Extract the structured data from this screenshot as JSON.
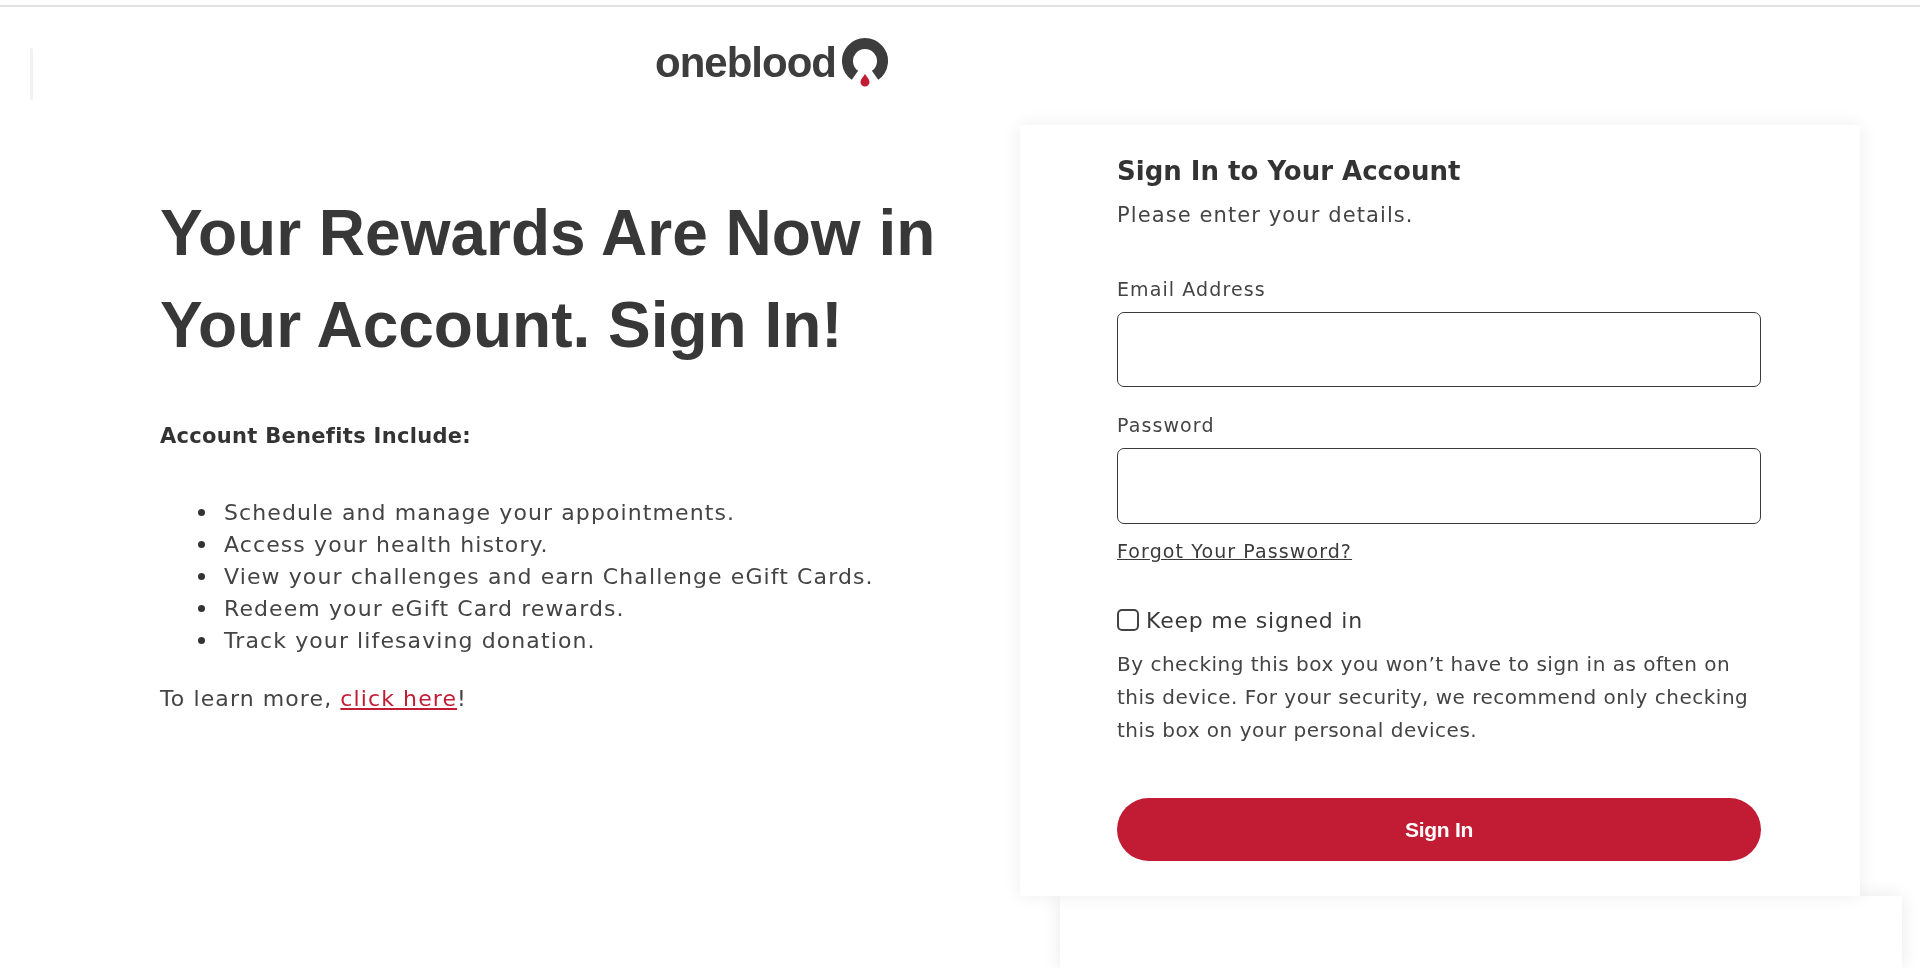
{
  "header": {
    "logo_text": "oneblood"
  },
  "promo": {
    "heading": "Your Rewards Are Now in Your Account. Sign In!",
    "benefits_title": "Account Benefits Include:",
    "benefits": [
      "Schedule and manage your appointments.",
      "Access your health history.",
      "View your challenges and earn Challenge eGift Cards.",
      "Redeem your eGift Card rewards.",
      "Track your lifesaving donation."
    ],
    "learn_more": {
      "before": "To learn more, ",
      "link": "click here",
      "after": "!"
    }
  },
  "sign_in": {
    "title": "Sign In to Your Account",
    "subtitle": "Please enter your details.",
    "fields": [
      {
        "label": "Email Address"
      },
      {
        "label": "Password"
      }
    ],
    "forgot_link": "Forgot Your Password?",
    "remember": {
      "label": "Keep me signed in",
      "checked": false
    },
    "remember_note": "By checking this box you won’t have to sign in as often on this device. For your security, we recommend only checking this box on your personal devices.",
    "button": "Sign In"
  }
}
